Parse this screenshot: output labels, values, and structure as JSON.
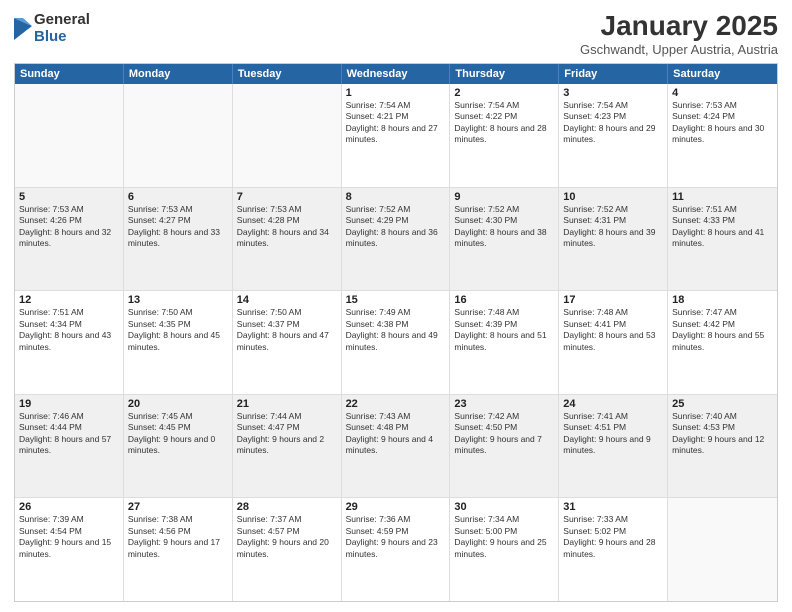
{
  "logo": {
    "general": "General",
    "blue": "Blue"
  },
  "header": {
    "month": "January 2025",
    "location": "Gschwandt, Upper Austria, Austria"
  },
  "weekdays": [
    "Sunday",
    "Monday",
    "Tuesday",
    "Wednesday",
    "Thursday",
    "Friday",
    "Saturday"
  ],
  "weeks": [
    [
      {
        "day": "",
        "text": ""
      },
      {
        "day": "",
        "text": ""
      },
      {
        "day": "",
        "text": ""
      },
      {
        "day": "1",
        "text": "Sunrise: 7:54 AM\nSunset: 4:21 PM\nDaylight: 8 hours and 27 minutes."
      },
      {
        "day": "2",
        "text": "Sunrise: 7:54 AM\nSunset: 4:22 PM\nDaylight: 8 hours and 28 minutes."
      },
      {
        "day": "3",
        "text": "Sunrise: 7:54 AM\nSunset: 4:23 PM\nDaylight: 8 hours and 29 minutes."
      },
      {
        "day": "4",
        "text": "Sunrise: 7:53 AM\nSunset: 4:24 PM\nDaylight: 8 hours and 30 minutes."
      }
    ],
    [
      {
        "day": "5",
        "text": "Sunrise: 7:53 AM\nSunset: 4:26 PM\nDaylight: 8 hours and 32 minutes."
      },
      {
        "day": "6",
        "text": "Sunrise: 7:53 AM\nSunset: 4:27 PM\nDaylight: 8 hours and 33 minutes."
      },
      {
        "day": "7",
        "text": "Sunrise: 7:53 AM\nSunset: 4:28 PM\nDaylight: 8 hours and 34 minutes."
      },
      {
        "day": "8",
        "text": "Sunrise: 7:52 AM\nSunset: 4:29 PM\nDaylight: 8 hours and 36 minutes."
      },
      {
        "day": "9",
        "text": "Sunrise: 7:52 AM\nSunset: 4:30 PM\nDaylight: 8 hours and 38 minutes."
      },
      {
        "day": "10",
        "text": "Sunrise: 7:52 AM\nSunset: 4:31 PM\nDaylight: 8 hours and 39 minutes."
      },
      {
        "day": "11",
        "text": "Sunrise: 7:51 AM\nSunset: 4:33 PM\nDaylight: 8 hours and 41 minutes."
      }
    ],
    [
      {
        "day": "12",
        "text": "Sunrise: 7:51 AM\nSunset: 4:34 PM\nDaylight: 8 hours and 43 minutes."
      },
      {
        "day": "13",
        "text": "Sunrise: 7:50 AM\nSunset: 4:35 PM\nDaylight: 8 hours and 45 minutes."
      },
      {
        "day": "14",
        "text": "Sunrise: 7:50 AM\nSunset: 4:37 PM\nDaylight: 8 hours and 47 minutes."
      },
      {
        "day": "15",
        "text": "Sunrise: 7:49 AM\nSunset: 4:38 PM\nDaylight: 8 hours and 49 minutes."
      },
      {
        "day": "16",
        "text": "Sunrise: 7:48 AM\nSunset: 4:39 PM\nDaylight: 8 hours and 51 minutes."
      },
      {
        "day": "17",
        "text": "Sunrise: 7:48 AM\nSunset: 4:41 PM\nDaylight: 8 hours and 53 minutes."
      },
      {
        "day": "18",
        "text": "Sunrise: 7:47 AM\nSunset: 4:42 PM\nDaylight: 8 hours and 55 minutes."
      }
    ],
    [
      {
        "day": "19",
        "text": "Sunrise: 7:46 AM\nSunset: 4:44 PM\nDaylight: 8 hours and 57 minutes."
      },
      {
        "day": "20",
        "text": "Sunrise: 7:45 AM\nSunset: 4:45 PM\nDaylight: 9 hours and 0 minutes."
      },
      {
        "day": "21",
        "text": "Sunrise: 7:44 AM\nSunset: 4:47 PM\nDaylight: 9 hours and 2 minutes."
      },
      {
        "day": "22",
        "text": "Sunrise: 7:43 AM\nSunset: 4:48 PM\nDaylight: 9 hours and 4 minutes."
      },
      {
        "day": "23",
        "text": "Sunrise: 7:42 AM\nSunset: 4:50 PM\nDaylight: 9 hours and 7 minutes."
      },
      {
        "day": "24",
        "text": "Sunrise: 7:41 AM\nSunset: 4:51 PM\nDaylight: 9 hours and 9 minutes."
      },
      {
        "day": "25",
        "text": "Sunrise: 7:40 AM\nSunset: 4:53 PM\nDaylight: 9 hours and 12 minutes."
      }
    ],
    [
      {
        "day": "26",
        "text": "Sunrise: 7:39 AM\nSunset: 4:54 PM\nDaylight: 9 hours and 15 minutes."
      },
      {
        "day": "27",
        "text": "Sunrise: 7:38 AM\nSunset: 4:56 PM\nDaylight: 9 hours and 17 minutes."
      },
      {
        "day": "28",
        "text": "Sunrise: 7:37 AM\nSunset: 4:57 PM\nDaylight: 9 hours and 20 minutes."
      },
      {
        "day": "29",
        "text": "Sunrise: 7:36 AM\nSunset: 4:59 PM\nDaylight: 9 hours and 23 minutes."
      },
      {
        "day": "30",
        "text": "Sunrise: 7:34 AM\nSunset: 5:00 PM\nDaylight: 9 hours and 25 minutes."
      },
      {
        "day": "31",
        "text": "Sunrise: 7:33 AM\nSunset: 5:02 PM\nDaylight: 9 hours and 28 minutes."
      },
      {
        "day": "",
        "text": ""
      }
    ]
  ]
}
